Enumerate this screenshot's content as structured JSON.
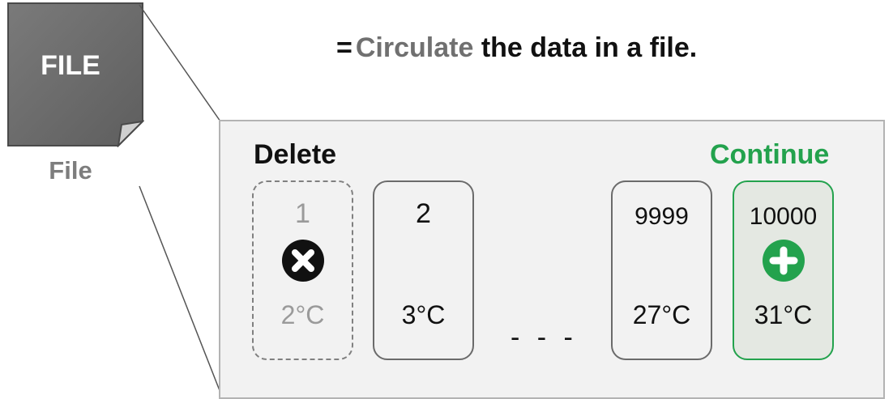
{
  "headline": {
    "equals": "=",
    "highlight": "Circulate",
    "rest": "the data in a file."
  },
  "file": {
    "icon_label": "FILE",
    "caption": "File",
    "icon": "file-icon"
  },
  "zones": {
    "delete_label": "Delete",
    "continue_label": "Continue"
  },
  "cards": [
    {
      "number": "1",
      "temp": "2°C",
      "state": "deleted",
      "icon": "delete-x-icon"
    },
    {
      "number": "2",
      "temp": "3°C",
      "state": "normal"
    },
    {
      "number": "9999",
      "temp": "27°C",
      "state": "normal"
    },
    {
      "number": "10000",
      "temp": "31°C",
      "state": "added",
      "icon": "add-plus-icon"
    }
  ],
  "ellipsis": "- - -",
  "colors": {
    "accent_green": "#23a24d",
    "file_gray": "#707070",
    "panel_bg": "#f2f2f2",
    "deleted_gray": "#9a9a9a"
  }
}
